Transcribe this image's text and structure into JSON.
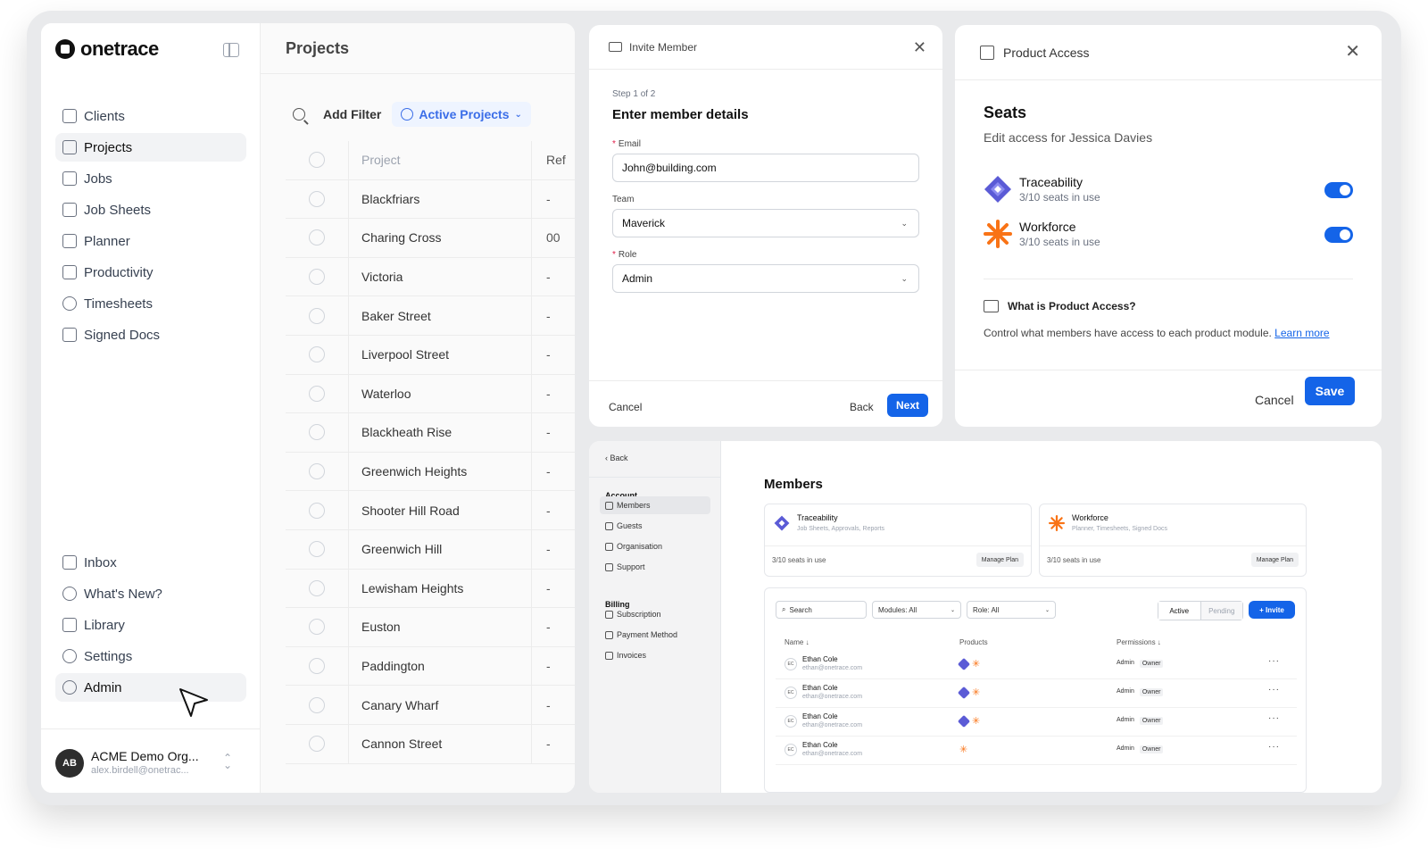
{
  "brand": {
    "name": "onetrace"
  },
  "sidebar": {
    "main_items": [
      {
        "label": "Clients",
        "icon": "briefcase-icon"
      },
      {
        "label": "Projects",
        "icon": "cube-icon",
        "active": true
      },
      {
        "label": "Jobs",
        "icon": "jobs-icon"
      },
      {
        "label": "Job Sheets",
        "icon": "job-sheets-icon"
      },
      {
        "label": "Planner",
        "icon": "calendar-icon"
      },
      {
        "label": "Productivity",
        "icon": "chart-icon"
      },
      {
        "label": "Timesheets",
        "icon": "clock-icon"
      },
      {
        "label": "Signed Docs",
        "icon": "signature-icon"
      }
    ],
    "bottom_items": [
      {
        "label": "Inbox",
        "icon": "inbox-icon"
      },
      {
        "label": "What's New?",
        "icon": "sparkle-icon"
      },
      {
        "label": "Library",
        "icon": "grid-icon"
      },
      {
        "label": "Settings",
        "icon": "gear-icon"
      },
      {
        "label": "Admin",
        "icon": "admin-icon",
        "active": true
      }
    ],
    "profile": {
      "initials": "AB",
      "org": "ACME Demo Org...",
      "email": "alex.birdell@onetrac..."
    }
  },
  "projects": {
    "title": "Projects",
    "add_filter": "Add Filter",
    "active_filter": "Active Projects",
    "columns": {
      "project": "Project",
      "ref": "Ref"
    },
    "rows": [
      {
        "name": "Blackfriars",
        "ref": "-"
      },
      {
        "name": "Charing Cross",
        "ref": "00"
      },
      {
        "name": "Victoria",
        "ref": "-"
      },
      {
        "name": "Baker Street",
        "ref": "-"
      },
      {
        "name": "Liverpool Street",
        "ref": "-"
      },
      {
        "name": "Waterloo",
        "ref": "-"
      },
      {
        "name": "Blackheath Rise",
        "ref": "-"
      },
      {
        "name": "Greenwich Heights",
        "ref": "-"
      },
      {
        "name": "Shooter Hill Road",
        "ref": "-"
      },
      {
        "name": "Greenwich Hill",
        "ref": "-"
      },
      {
        "name": "Lewisham Heights",
        "ref": "-"
      },
      {
        "name": "Euston",
        "ref": "-"
      },
      {
        "name": "Paddington",
        "ref": "-"
      },
      {
        "name": "Canary Wharf",
        "ref": "-"
      },
      {
        "name": "Cannon Street",
        "ref": "-"
      }
    ]
  },
  "invite": {
    "title": "Invite Member",
    "step": "Step 1 of 2",
    "heading": "Enter member details",
    "email_label": "Email",
    "email_value": "John@building.com",
    "team_label": "Team",
    "team_value": "Maverick",
    "role_label": "Role",
    "role_value": "Admin",
    "cancel": "Cancel",
    "back": "Back",
    "next": "Next"
  },
  "access": {
    "title": "Product Access",
    "seats_title": "Seats",
    "seats_sub": "Edit access for Jessica Davies",
    "products": [
      {
        "name": "Traceability",
        "seats": "3/10 seats in use",
        "enabled": true
      },
      {
        "name": "Workforce",
        "seats": "3/10 seats in use",
        "enabled": true
      }
    ],
    "question": "What is Product Access?",
    "desc": "Control what members have access to each product module.",
    "learn_more": "Learn more",
    "cancel": "Cancel",
    "save": "Save"
  },
  "members": {
    "back": "Back",
    "account_label": "Account",
    "account_items": [
      "Members",
      "Guests",
      "Organisation",
      "Support"
    ],
    "billing_label": "Billing",
    "billing_items": [
      "Subscription",
      "Payment Method",
      "Invoices"
    ],
    "title": "Members",
    "cards": [
      {
        "name": "Traceability",
        "modules": "Job Sheets, Approvals, Reports",
        "seats": "3/10 seats in use",
        "button": "Manage Plan"
      },
      {
        "name": "Workforce",
        "modules": "Planner, Timesheets, Signed Docs",
        "seats": "3/10 seats in use",
        "button": "Manage Plan"
      }
    ],
    "search_placeholder": "Search",
    "modules_filter": "Modules: All",
    "role_filter": "Role: All",
    "tab_active": "Active",
    "tab_pending": "Pending",
    "invite_button": "+ Invite",
    "col_name": "Name ↓",
    "col_products": "Products",
    "col_permissions": "Permissions ↓",
    "rows": [
      {
        "initials": "EC",
        "name": "Ethan Cole",
        "email": "ethan@onetrace.com",
        "traceability": true,
        "workforce": true,
        "role": "Admin",
        "badge": "Owner"
      },
      {
        "initials": "EC",
        "name": "Ethan Cole",
        "email": "ethan@onetrace.com",
        "traceability": true,
        "workforce": true,
        "role": "Admin",
        "badge": "Owner"
      },
      {
        "initials": "EC",
        "name": "Ethan Cole",
        "email": "ethan@onetrace.com",
        "traceability": true,
        "workforce": true,
        "role": "Admin",
        "badge": "Owner"
      },
      {
        "initials": "EC",
        "name": "Ethan Cole",
        "email": "ethan@onetrace.com",
        "traceability": false,
        "workforce": true,
        "role": "Admin",
        "badge": "Owner"
      }
    ]
  },
  "colors": {
    "accent": "#1464e8",
    "traceability": "#5b5bd6",
    "workforce": "#f97316"
  }
}
